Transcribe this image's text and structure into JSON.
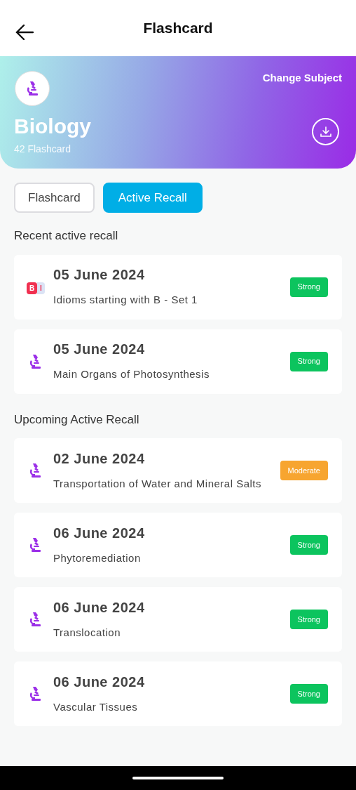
{
  "header": {
    "title": "Flashcard"
  },
  "subject": {
    "name": "Biology",
    "count": "42 Flashcard",
    "action": "Change Subject"
  },
  "tabs": [
    {
      "label": "Flashcard",
      "selected": false
    },
    {
      "label": "Active Recall",
      "selected": true
    }
  ],
  "sections": [
    {
      "title": "Recent active recall",
      "items": [
        {
          "date": "05 June 2024",
          "topic": "Idioms starting with B - Set 1",
          "icon": {
            "kind": "letters",
            "letters": [
              "B",
              "I"
            ]
          },
          "status": "Strong",
          "color": "#0cc45e"
        },
        {
          "date": "05 June 2024",
          "topic": "Main Organs of Photosynthesis",
          "icon": {
            "kind": "microscope"
          },
          "status": "Strong",
          "color": "#0cc45e"
        }
      ]
    },
    {
      "title": "Upcoming Active Recall",
      "items": [
        {
          "date": "02 June 2024",
          "topic": "Transportation of Water and Mineral Salts",
          "icon": {
            "kind": "microscope"
          },
          "status": "Moderate",
          "color": "#f7a530"
        },
        {
          "date": "06 June 2024",
          "topic": "Phytoremediation",
          "icon": {
            "kind": "microscope"
          },
          "status": "Strong",
          "color": "#0cc45e"
        },
        {
          "date": "06 June 2024",
          "topic": "Translocation",
          "icon": {
            "kind": "microscope"
          },
          "status": "Strong",
          "color": "#0cc45e"
        },
        {
          "date": "06 June 2024",
          "topic": "Vascular Tissues",
          "icon": {
            "kind": "microscope"
          },
          "status": "Strong",
          "color": "#0cc45e"
        }
      ]
    }
  ]
}
